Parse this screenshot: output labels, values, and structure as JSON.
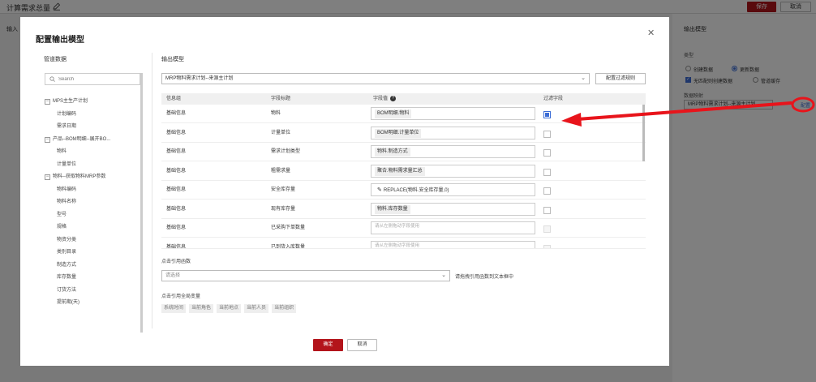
{
  "page": {
    "title": "计算需求总量",
    "save_label": "保存",
    "cancel_label": "取消",
    "left_section_title": "输入"
  },
  "right_panel": {
    "title": "输出模型",
    "type_label": "类型",
    "options": {
      "create": "创建数据",
      "update": "更新数据",
      "create_if_missing": "无匹配则创建数据",
      "pipeline_cache": "管道缓存"
    },
    "selected_type": "更新数据",
    "create_if_missing_checked": true,
    "mapping_label": "数据映射",
    "mapping_value": "MRP物料需求计划--来源主计划",
    "config_link": "配置"
  },
  "modal": {
    "title": "配置输出模型",
    "close_icon": "close-icon",
    "left": {
      "title": "管道数据",
      "search_placeholder": "Search",
      "tree": [
        {
          "label": "MPS主生产计划",
          "level": 0
        },
        {
          "label": "计划编码",
          "level": 1
        },
        {
          "label": "需求日期",
          "level": 1
        },
        {
          "label": "产品--BOM明细--展开BO...",
          "level": 0
        },
        {
          "label": "物料",
          "level": 1
        },
        {
          "label": "计量单位",
          "level": 1
        },
        {
          "label": "物料--获取物料MRP参数",
          "level": 0
        },
        {
          "label": "物料编码",
          "level": 1
        },
        {
          "label": "物料名称",
          "level": 1
        },
        {
          "label": "型号",
          "level": 1
        },
        {
          "label": "规格",
          "level": 1
        },
        {
          "label": "物资分类",
          "level": 1
        },
        {
          "label": "类别目录",
          "level": 1
        },
        {
          "label": "制造方式",
          "level": 1
        },
        {
          "label": "库存数量",
          "level": 1
        },
        {
          "label": "订货方法",
          "level": 1
        },
        {
          "label": "提前期(天)",
          "level": 1
        }
      ]
    },
    "right": {
      "title": "输出模型",
      "model_value": "MRP物料需求计划--来源主计划",
      "filter_button": "配置过滤规则",
      "columns": {
        "group": "信息组",
        "field_title": "字段标题",
        "field_value": "字段值",
        "filter_field": "过滤字段"
      },
      "rows": [
        {
          "group": "基础信息",
          "title": "物料",
          "value": "BOM明细.物料",
          "placeholder": "",
          "edit": false,
          "filter": "checked"
        },
        {
          "group": "基础信息",
          "title": "计量单位",
          "value": "BOM明细.计量单位",
          "placeholder": "",
          "edit": false,
          "filter": "unchecked"
        },
        {
          "group": "基础信息",
          "title": "需求计划类型",
          "value": "物料.制造方式",
          "placeholder": "",
          "edit": false,
          "filter": "unchecked"
        },
        {
          "group": "基础信息",
          "title": "粗需求量",
          "value": "聚合.物料需求量汇总",
          "placeholder": "",
          "edit": false,
          "filter": "unchecked"
        },
        {
          "group": "基础信息",
          "title": "安全库存量",
          "value": "REPLACE(物料.安全库存量,0)",
          "placeholder": "",
          "edit": true,
          "filter": "unchecked"
        },
        {
          "group": "基础信息",
          "title": "现有库存量",
          "value": "物料.库存数量",
          "placeholder": "",
          "edit": false,
          "filter": "unchecked"
        },
        {
          "group": "基础信息",
          "title": "已采购下单数量",
          "value": "",
          "placeholder": "请从左侧拖动字段使用",
          "edit": false,
          "filter": "disabled"
        },
        {
          "group": "基础信息",
          "title": "已到货入库数量",
          "value": "",
          "placeholder": "请从左侧拖动字段使用",
          "edit": false,
          "filter": "disabled"
        }
      ],
      "function_label": "点击引用函数",
      "function_placeholder": "请选择",
      "function_hint": "请拖拽引用函数到文本框中",
      "globals_label": "点击引用全局变量",
      "globals": [
        "系统时间",
        "当前角色",
        "当前地点",
        "当前人员",
        "当前组织"
      ]
    },
    "ok_label": "确定",
    "cancel_label": "取消"
  },
  "annotation": {
    "color": "#e8141b",
    "description_icon": "red-arrow-icon"
  }
}
